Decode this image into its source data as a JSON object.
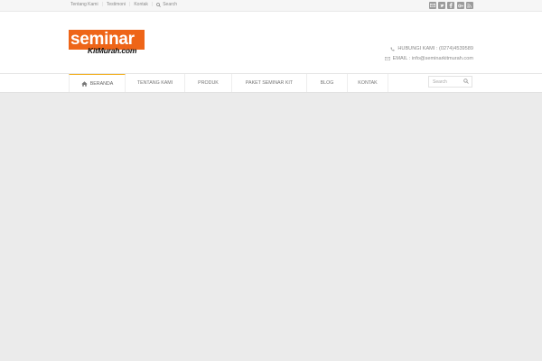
{
  "topbar": {
    "links": [
      "Tentang Kami",
      "Testimoni",
      "Kontak"
    ],
    "search_label": "Search",
    "social_icons": [
      "email-icon",
      "twitter-icon",
      "facebook-icon",
      "google-plus-icon",
      "rss-icon"
    ]
  },
  "logo": {
    "main": "seminar",
    "sub": "KitMurah.com",
    "color": "#ee6518"
  },
  "contact": {
    "phone": "HUBUNGI KAMI : (0274)4539589",
    "email": "EMAIL : info@seminarkitmurah.com"
  },
  "nav": {
    "items": [
      {
        "label": "BERANDA",
        "active": true
      },
      {
        "label": "TENTANG KAMI"
      },
      {
        "label": "PRODUK"
      },
      {
        "label": "PAKET SEMINAR KIT"
      },
      {
        "label": "BLOG"
      },
      {
        "label": "KONTAK"
      }
    ],
    "search_placeholder": "Search",
    "accent": "#f2b021"
  }
}
